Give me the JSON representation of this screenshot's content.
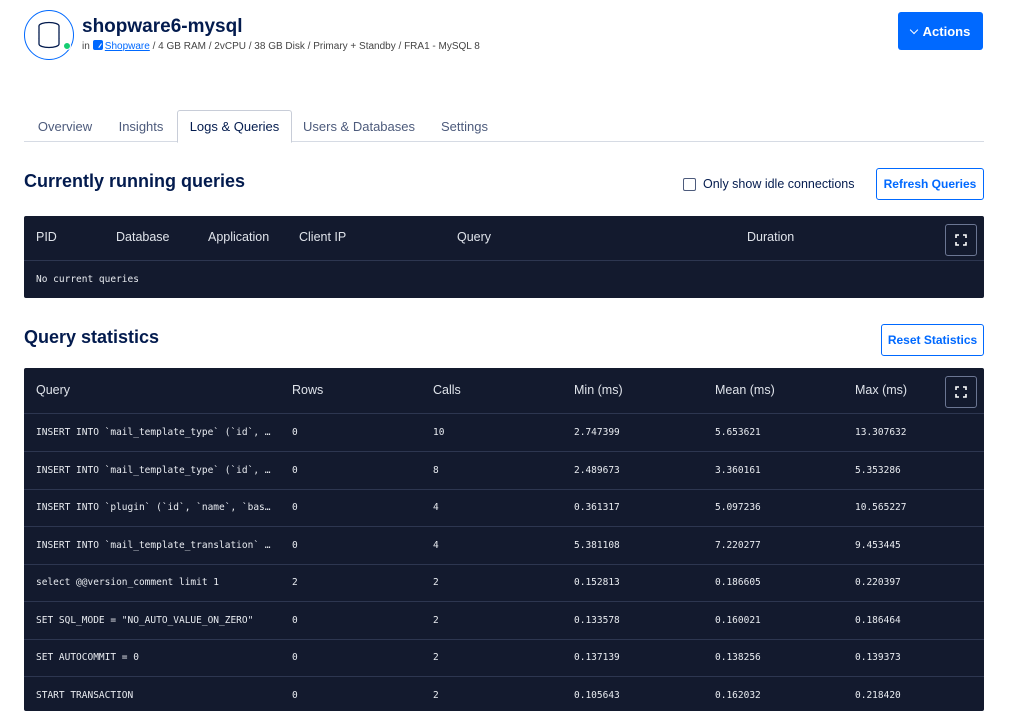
{
  "header": {
    "title": "shopware6-mysql",
    "in_label": "in",
    "project_link": "Shopware",
    "specs": "/ 4 GB RAM / 2vCPU / 38 GB Disk / Primary + Standby / FRA1 - MySQL 8",
    "status_color": "#15cd72",
    "actions_label": "Actions"
  },
  "tabs": [
    {
      "label": "Overview"
    },
    {
      "label": "Insights"
    },
    {
      "label": "Logs & Queries",
      "active": true
    },
    {
      "label": "Users & Databases"
    },
    {
      "label": "Settings"
    }
  ],
  "running": {
    "title": "Currently running queries",
    "checkbox_label": "Only show idle connections",
    "refresh_label": "Refresh Queries",
    "columns": [
      "PID",
      "Database",
      "Application",
      "Client IP",
      "Query",
      "Duration"
    ],
    "empty_text": "No current queries"
  },
  "stats": {
    "title": "Query statistics",
    "reset_label": "Reset Statistics",
    "columns": [
      "Query",
      "Rows",
      "Calls",
      "Min (ms)",
      "Mean (ms)",
      "Max (ms)"
    ],
    "rows": [
      [
        "INSERT INTO `mail_template_type` (`id`, …",
        "0",
        "10",
        "2.747399",
        "5.653621",
        "13.307632"
      ],
      [
        "INSERT INTO `mail_template_type` (`id`, …",
        "0",
        "8",
        "2.489673",
        "3.360161",
        "5.353286"
      ],
      [
        "INSERT INTO `plugin` (`id`, `name`, `bas…",
        "0",
        "4",
        "0.361317",
        "5.097236",
        "10.565227"
      ],
      [
        "INSERT INTO `mail_template_translation` …",
        "0",
        "4",
        "5.381108",
        "7.220277",
        "9.453445"
      ],
      [
        "select @@version_comment limit 1",
        "2",
        "2",
        "0.152813",
        "0.186605",
        "0.220397"
      ],
      [
        "SET SQL_MODE = \"NO_AUTO_VALUE_ON_ZERO\"",
        "0",
        "2",
        "0.133578",
        "0.160021",
        "0.186464"
      ],
      [
        "SET AUTOCOMMIT = 0",
        "0",
        "2",
        "0.137139",
        "0.138256",
        "0.139373"
      ],
      [
        "START TRANSACTION",
        "0",
        "2",
        "0.105643",
        "0.162032",
        "0.218420"
      ]
    ]
  },
  "colors": {
    "accent": "#0069ff",
    "panel_bg": "#131a2e",
    "text": "#031b4e"
  }
}
